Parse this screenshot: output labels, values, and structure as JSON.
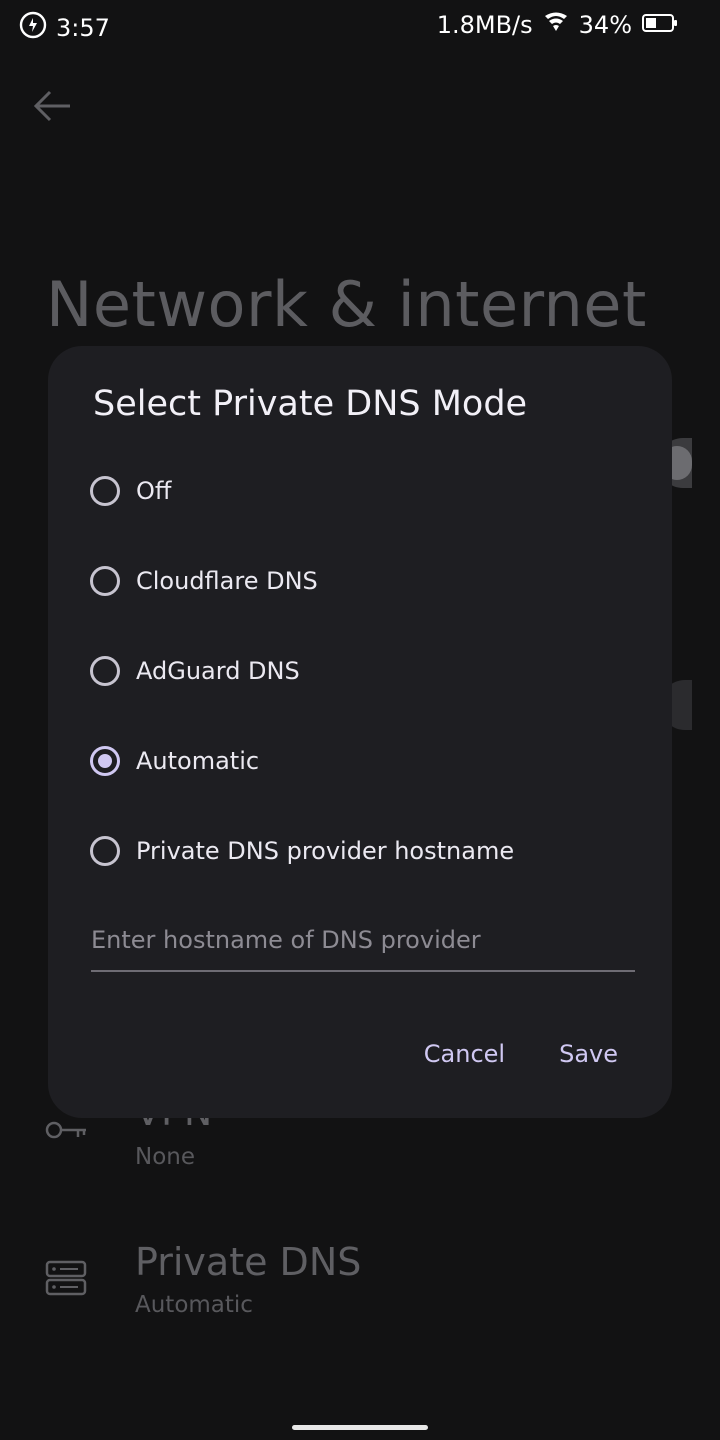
{
  "status_bar": {
    "time": "3:57",
    "network_speed": "1.8MB/s",
    "battery": "34%",
    "icons": [
      "data-saver-icon",
      "wifi-icon",
      "battery-icon"
    ]
  },
  "page": {
    "title": "Network & internet",
    "back_icon": "arrow-left-icon",
    "rows": [
      {
        "title": "VPN",
        "subtitle": "None",
        "icon": "key-icon"
      },
      {
        "title": "Private DNS",
        "subtitle": "Automatic",
        "icon": "dns-server-icon"
      }
    ]
  },
  "dialog": {
    "title": "Select Private DNS Mode",
    "options": [
      {
        "label": "Off",
        "selected": false
      },
      {
        "label": "Cloudflare DNS",
        "selected": false
      },
      {
        "label": "AdGuard DNS",
        "selected": false
      },
      {
        "label": "Automatic",
        "selected": true
      },
      {
        "label": "Private DNS provider hostname",
        "selected": false
      }
    ],
    "hostname_placeholder": "Enter hostname of DNS provider",
    "hostname_value": "",
    "cancel_label": "Cancel",
    "save_label": "Save"
  },
  "colors": {
    "accent": "#d0c8f2",
    "dialog_bg": "#1e1e22",
    "screen_bg": "#121213"
  }
}
